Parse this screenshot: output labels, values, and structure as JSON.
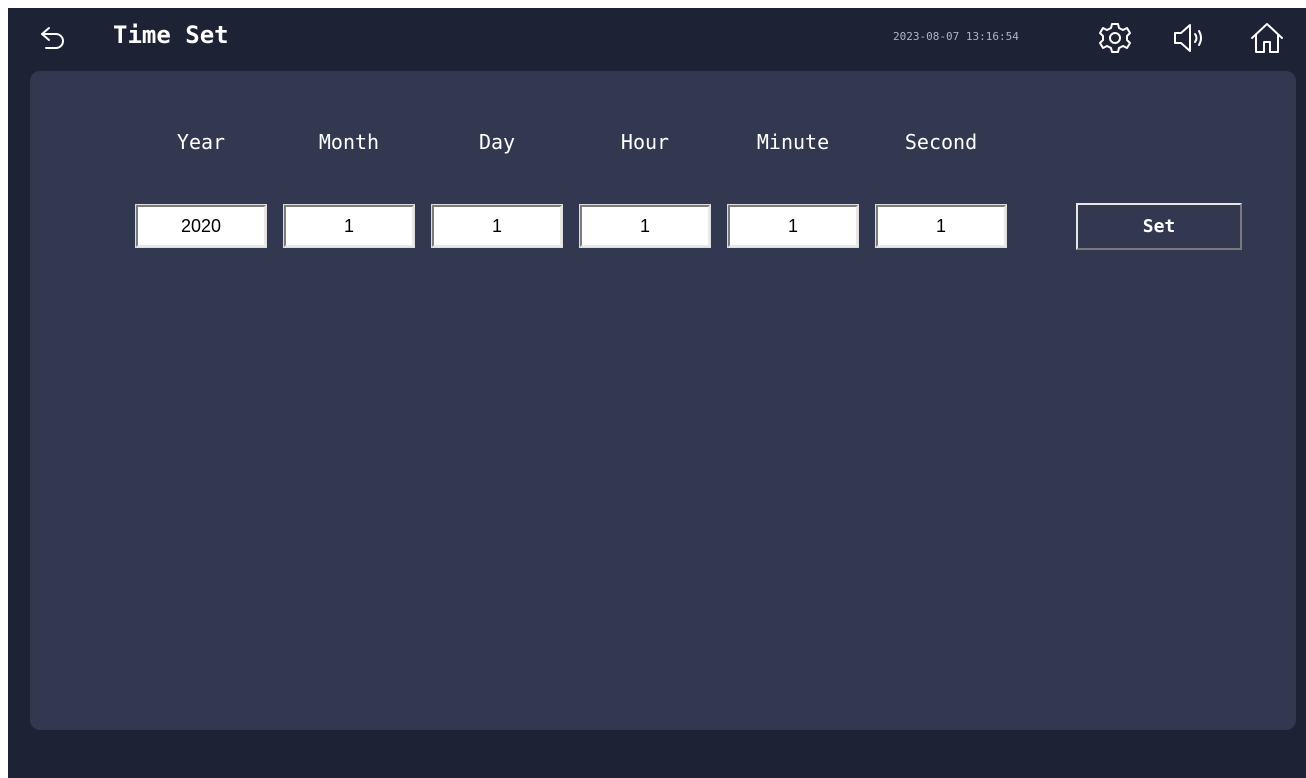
{
  "header": {
    "title": "Time Set",
    "datetime": "2023-08-07 13:16:54",
    "icons": {
      "back": "back-arrow-icon",
      "settings": "gear-icon",
      "volume": "speaker-icon",
      "home": "home-icon"
    }
  },
  "time_form": {
    "labels": {
      "year": "Year",
      "month": "Month",
      "day": "Day",
      "hour": "Hour",
      "minute": "Minute",
      "second": "Second"
    },
    "values": {
      "year": "2020",
      "month": "1",
      "day": "1",
      "hour": "1",
      "minute": "1",
      "second": "1"
    },
    "set_label": "Set"
  },
  "colors": {
    "background": "#1e2235",
    "panel": "#313850",
    "text": "#ffffff",
    "input_background": "#ffffff"
  }
}
